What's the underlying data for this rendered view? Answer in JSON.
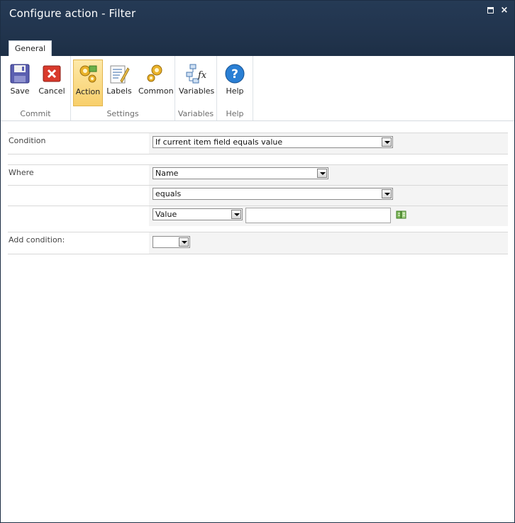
{
  "window": {
    "title": "Configure action - Filter",
    "maximize_label": "maximize",
    "close_label": "×"
  },
  "ribbon": {
    "tab_label": "General",
    "groups": {
      "commit": "Commit",
      "settings": "Settings",
      "variables": "Variables",
      "help": "Help"
    },
    "buttons": {
      "save": "Save",
      "cancel": "Cancel",
      "action": "Action",
      "labels": "Labels",
      "common": "Common",
      "variables": "Variables",
      "help": "Help"
    },
    "active_button": "Action"
  },
  "form": {
    "condition_label": "Condition",
    "condition_value": "If current item field equals value",
    "where_label": "Where",
    "field_value": "Name",
    "operator_value": "equals",
    "value_type": "Value",
    "value_text": "",
    "add_condition_label": "Add condition:",
    "add_condition_value": ""
  },
  "colors": {
    "titlebar": "#21344d",
    "active_button": "#f8cf6b",
    "field_background": "#f4f4f4"
  }
}
